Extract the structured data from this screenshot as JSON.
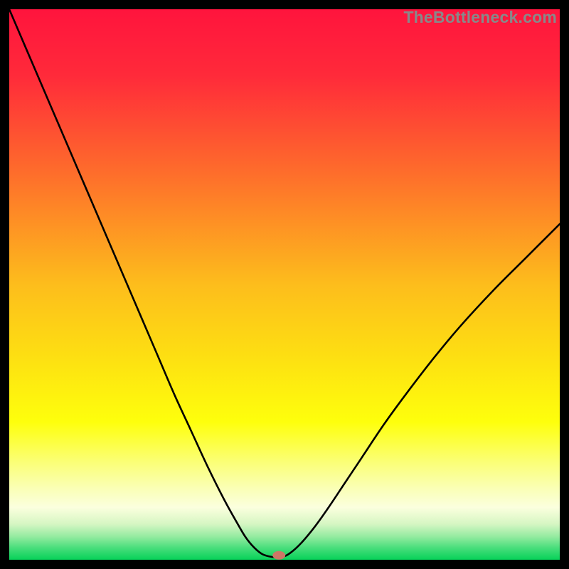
{
  "watermark": "TheBottleneck.com",
  "chart_data": {
    "type": "line",
    "title": "",
    "xlabel": "",
    "ylabel": "",
    "xlim": [
      0,
      100
    ],
    "ylim": [
      0,
      100
    ],
    "gradient_stops": [
      {
        "offset": 0.0,
        "color": "#ff143d"
      },
      {
        "offset": 0.12,
        "color": "#ff2a3a"
      },
      {
        "offset": 0.3,
        "color": "#fe6e2b"
      },
      {
        "offset": 0.5,
        "color": "#fdbd1c"
      },
      {
        "offset": 0.63,
        "color": "#fddf12"
      },
      {
        "offset": 0.75,
        "color": "#feff0c"
      },
      {
        "offset": 0.82,
        "color": "#fbff73"
      },
      {
        "offset": 0.87,
        "color": "#faffb5"
      },
      {
        "offset": 0.905,
        "color": "#fbffde"
      },
      {
        "offset": 0.935,
        "color": "#d6f6c3"
      },
      {
        "offset": 0.958,
        "color": "#94eba0"
      },
      {
        "offset": 0.978,
        "color": "#4ade7c"
      },
      {
        "offset": 1.0,
        "color": "#07d259"
      }
    ],
    "series": [
      {
        "name": "bottleneck-curve",
        "x": [
          0.0,
          3.0,
          6.0,
          9.0,
          12.0,
          15.0,
          18.0,
          21.0,
          24.0,
          27.0,
          30.0,
          33.0,
          36.0,
          39.0,
          41.5,
          43.0,
          44.5,
          46.0,
          47.8,
          49.5,
          51.0,
          53.0,
          55.5,
          58.0,
          61.0,
          64.0,
          68.0,
          72.0,
          77.0,
          82.0,
          88.0,
          94.0,
          100.0
        ],
        "y": [
          100.0,
          93.0,
          86.0,
          79.0,
          72.0,
          65.0,
          58.0,
          51.0,
          44.0,
          37.0,
          30.0,
          23.5,
          17.0,
          11.0,
          6.5,
          4.0,
          2.2,
          1.0,
          0.5,
          0.5,
          1.2,
          3.0,
          6.0,
          9.5,
          14.0,
          18.5,
          24.5,
          30.0,
          36.5,
          42.5,
          49.0,
          55.0,
          61.0
        ]
      }
    ],
    "marker": {
      "x": 49.0,
      "y": 0.8,
      "color": "#cc7766"
    }
  }
}
